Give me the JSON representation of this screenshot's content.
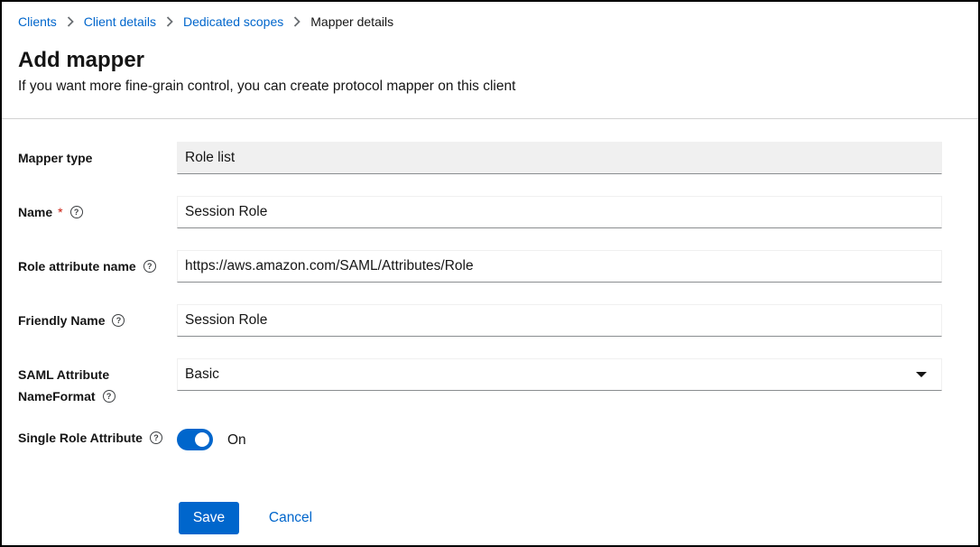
{
  "breadcrumb": {
    "items": [
      "Clients",
      "Client details",
      "Dedicated scopes"
    ],
    "current": "Mapper details"
  },
  "page": {
    "title": "Add mapper",
    "subtitle": "If you want more fine-grain control, you can create protocol mapper on this client"
  },
  "form": {
    "mapper_type": {
      "label": "Mapper type",
      "value": "Role list"
    },
    "name": {
      "label": "Name",
      "required_mark": "*",
      "value": "Session Role"
    },
    "role_attribute_name": {
      "label": "Role attribute name",
      "value": "https://aws.amazon.com/SAML/Attributes/Role"
    },
    "friendly_name": {
      "label": "Friendly Name",
      "value": "Session Role"
    },
    "saml_nameformat": {
      "label_line1": "SAML Attribute",
      "label_line2": "NameFormat",
      "value": "Basic"
    },
    "single_role_attribute": {
      "label": "Single Role Attribute",
      "state_text": "On",
      "checked": true
    }
  },
  "actions": {
    "save_label": "Save",
    "cancel_label": "Cancel"
  },
  "colors": {
    "accent": "#0066cc",
    "required": "#c9190b"
  },
  "icons": {
    "help": "question-circle-icon",
    "separator": "chevron-right-icon",
    "caret": "caret-down-icon"
  }
}
